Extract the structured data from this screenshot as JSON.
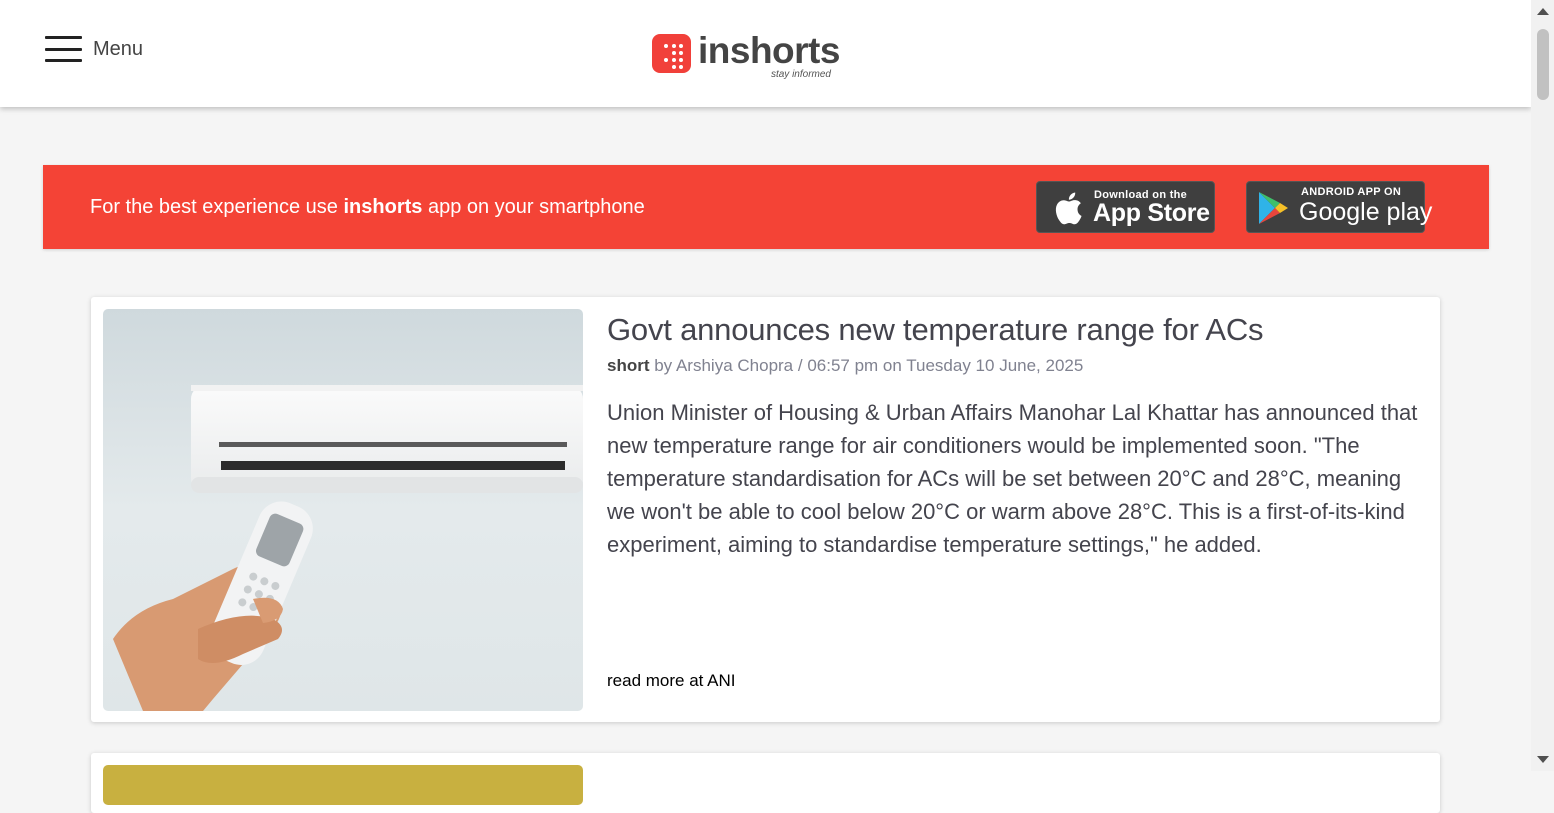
{
  "header": {
    "menu_label": "Menu",
    "logo_text": "inshorts",
    "logo_tagline": "stay informed"
  },
  "banner": {
    "text_before": "For the best experience use ",
    "text_brand": "inshorts",
    "text_after": " app on your smartphone",
    "appstore_small": "Download on the",
    "appstore_big": "App Store",
    "gplay_small": "ANDROID APP ON",
    "gplay_big": "Google play"
  },
  "article": {
    "title": "Govt announces new temperature range for ACs",
    "type_label": "short",
    "by_text": " by ",
    "author": "Arshiya Chopra",
    "separator": " / ",
    "time": "06:57 pm",
    "on_text": " on ",
    "date": "Tuesday 10 June, 2025",
    "summary": "Union Minister of Housing & Urban Affairs Manohar Lal Khattar has announced that new temperature range for air conditioners would be implemented soon. \"The temperature standardisation for ACs will be set between 20°C and 28°C, meaning we won't be able to cool below 20°C or warm above 28°C. This is a first-of-its-kind experiment, aiming to standardise temperature settings,\" he added.",
    "read_more_prefix": "read more at ",
    "source": "ANI"
  },
  "colors": {
    "brand_red": "#f44336",
    "logo_red": "#f1403a",
    "store_button": "#3f3f3f"
  },
  "icons": [
    "hamburger-icon",
    "inshorts-logo-icon",
    "apple-icon",
    "google-play-icon"
  ]
}
